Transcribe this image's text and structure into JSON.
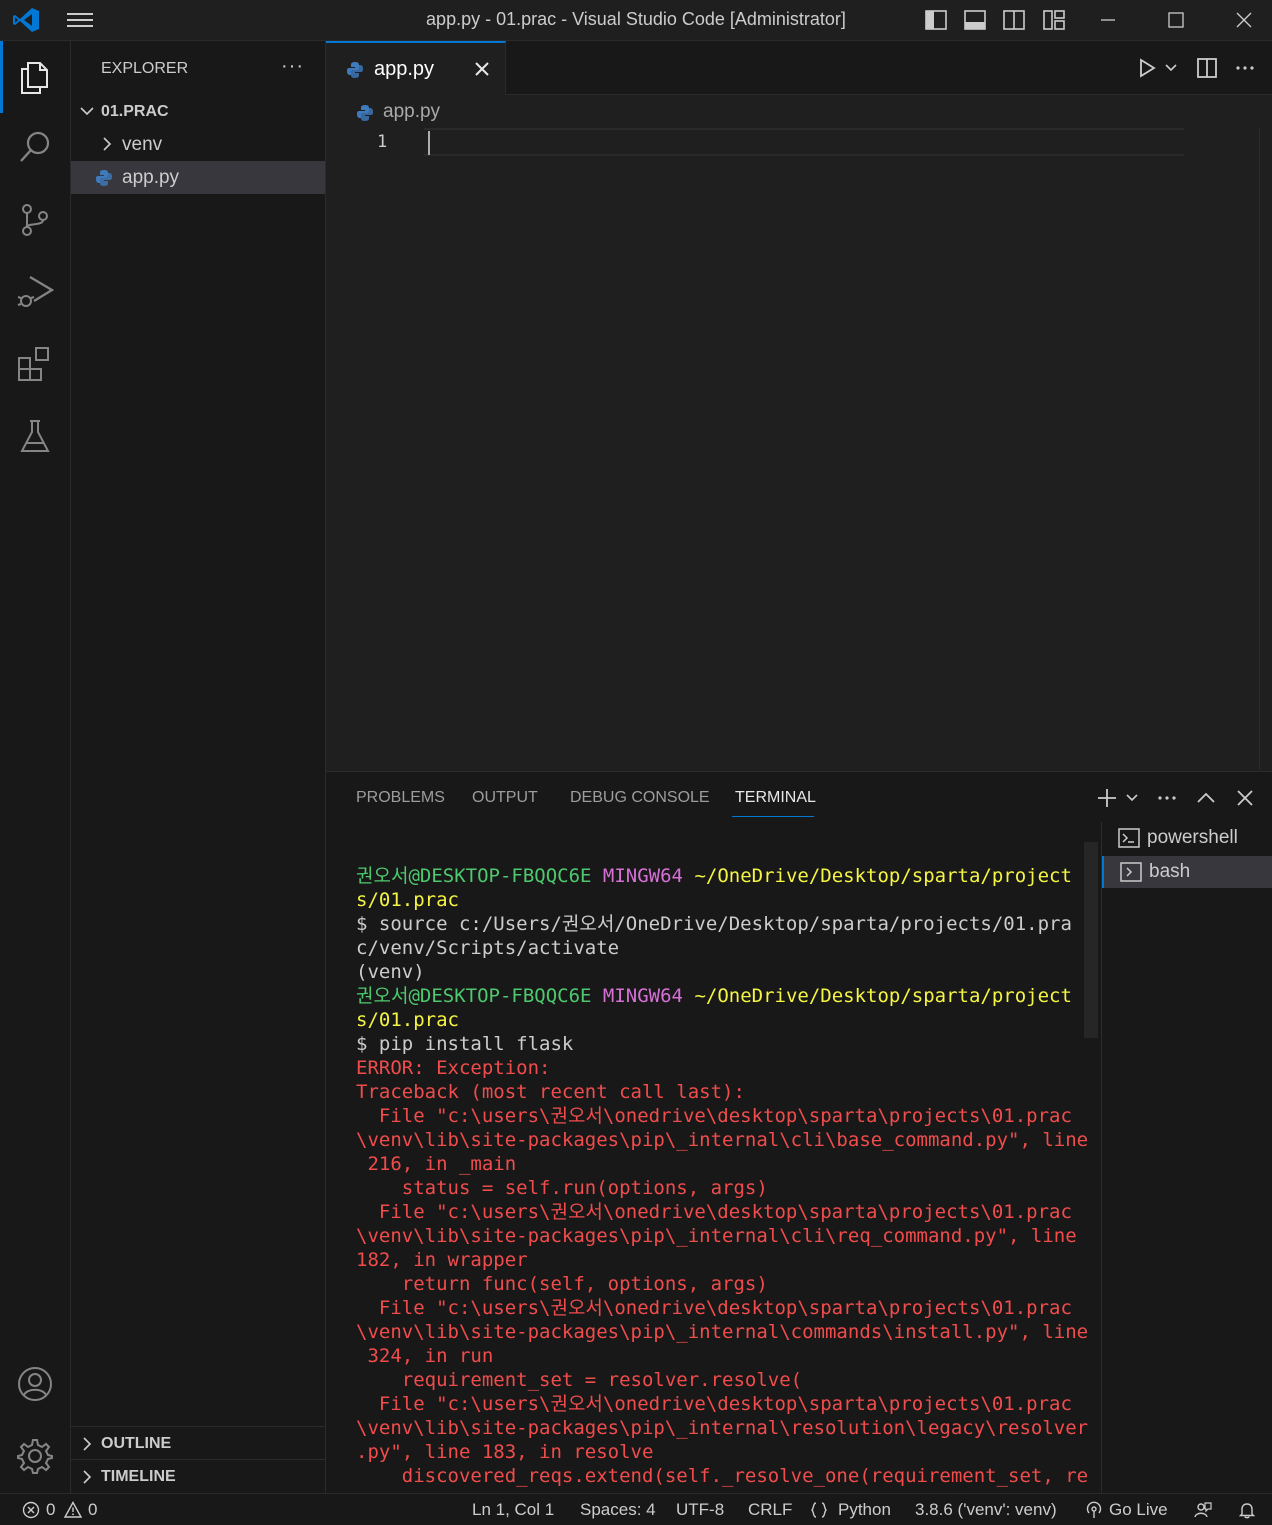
{
  "window": {
    "title": "app.py - 01.prac - Visual Studio Code [Administrator]"
  },
  "sidebar": {
    "title": "EXPLORER",
    "more": "···",
    "folder": "01.PRAC",
    "items": [
      {
        "label": "venv"
      },
      {
        "label": "app.py"
      }
    ],
    "outline": "OUTLINE",
    "timeline": "TIMELINE"
  },
  "editor": {
    "tab_label": "app.py",
    "breadcrumb": "app.py",
    "line_number": "1"
  },
  "panel": {
    "tabs": [
      "PROBLEMS",
      "OUTPUT",
      "DEBUG CONSOLE",
      "TERMINAL"
    ],
    "active_tab": "TERMINAL",
    "terminals": [
      "powershell",
      "bash"
    ]
  },
  "terminal": {
    "prompt_user": "권오서@DESKTOP-FBQQC6E",
    "prompt_env": "MINGW64",
    "prompt_path_a": "~/OneDrive/Desktop/sparta/project",
    "prompt_path_b": "s/01.prac",
    "cmd1_a": "$ source c:/Users/권오서/OneDrive/Desktop/sparta/projects/01.pra",
    "cmd1_b": "c/venv/Scripts/activate",
    "venv": "(venv)",
    "cmd2": "$ pip install flask",
    "error_lines": [
      "ERROR: Exception:",
      "Traceback (most recent call last):",
      "  File \"c:\\users\\권오서\\onedrive\\desktop\\sparta\\projects\\01.prac",
      "\\venv\\lib\\site-packages\\pip\\_internal\\cli\\base_command.py\", line",
      " 216, in _main",
      "    status = self.run(options, args)",
      "  File \"c:\\users\\권오서\\onedrive\\desktop\\sparta\\projects\\01.prac",
      "\\venv\\lib\\site-packages\\pip\\_internal\\cli\\req_command.py\", line",
      "182, in wrapper",
      "    return func(self, options, args)",
      "  File \"c:\\users\\권오서\\onedrive\\desktop\\sparta\\projects\\01.prac",
      "\\venv\\lib\\site-packages\\pip\\_internal\\commands\\install.py\", line",
      " 324, in run",
      "    requirement_set = resolver.resolve(",
      "  File \"c:\\users\\권오서\\onedrive\\desktop\\sparta\\projects\\01.prac",
      "\\venv\\lib\\site-packages\\pip\\_internal\\resolution\\legacy\\resolver",
      ".py\", line 183, in resolve",
      "    discovered_reqs.extend(self._resolve_one(requirement_set, re"
    ]
  },
  "status": {
    "errors": "0",
    "warnings": "0",
    "position": "Ln 1, Col 1",
    "spaces": "Spaces: 4",
    "encoding": "UTF-8",
    "eol": "CRLF",
    "language": "Python",
    "interpreter": "3.8.6 ('venv': venv)",
    "golive": "Go Live"
  },
  "colors": {
    "accent": "#0078d4",
    "prompt_green": "#4ec96e",
    "prompt_magenta": "#d670d6",
    "prompt_yellow": "#f5f543",
    "error_red": "#f14c4c"
  }
}
